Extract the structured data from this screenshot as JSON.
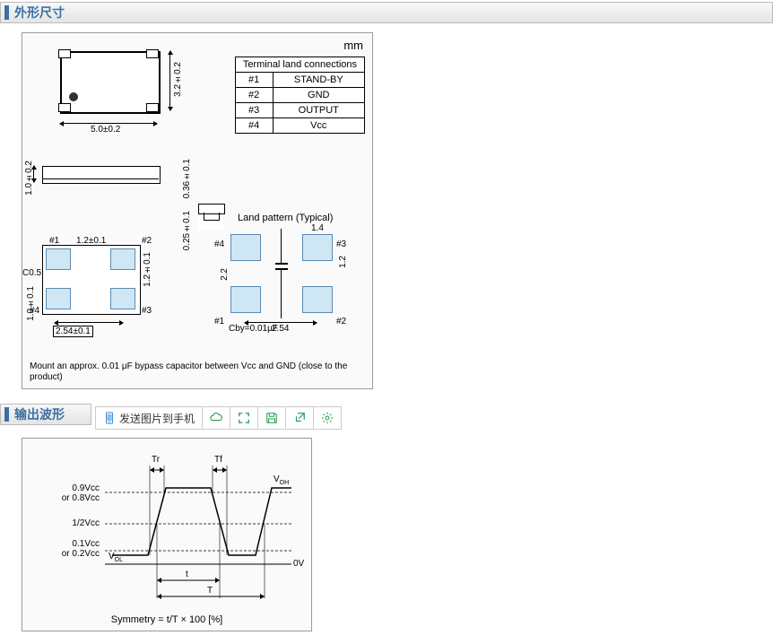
{
  "sections": {
    "dims_title": "外形尺寸",
    "wave_title": "输出波形"
  },
  "toolbar": {
    "send_label": "发送图片到手机"
  },
  "dimensions": {
    "unit": "mm",
    "terminal_header": "Terminal land connections",
    "pins": [
      {
        "num": "#1",
        "name": "STAND-BY"
      },
      {
        "num": "#2",
        "name": "GND"
      },
      {
        "num": "#3",
        "name": "OUTPUT"
      },
      {
        "num": "#4",
        "name": "Vcc"
      }
    ],
    "top_w": "5.0±0.2",
    "top_h": "3.2±0.2",
    "side_h": "1.0±0.2",
    "prof_h1": "0.36±0.1",
    "prof_h2": "0.25±0.1",
    "bot_pad_w": "1.2±0.1",
    "bot_pad_h": "1.2±0.1",
    "bot_pitch": "2.54±0.1",
    "bot_side": "1.0±0.1",
    "chamfer": "C0.5",
    "pin1": "#1",
    "pin2": "#2",
    "pin3": "#3",
    "pin4": "#4",
    "land_title": "Land pattern (Typical)",
    "land_w": "1.4",
    "land_h": "1.2",
    "land_pitch": "2.54",
    "land_gap": "2.2",
    "cby": "Cby=0.01μF",
    "note": "Mount an approx. 0.01 μF bypass capacitor between Vcc and GND (close to the product)"
  },
  "waveform": {
    "tr": "Tr",
    "tf": "Tf",
    "voh": "VOH",
    "vol": "VOL",
    "lvl_90": "0.9Vcc",
    "lvl_80": "or 0.8Vcc",
    "lvl_50": "1/2Vcc",
    "lvl_10": "0.1Vcc",
    "lvl_20": "or 0.2Vcc",
    "zero": "0V",
    "t_small": "t",
    "t_big": "T",
    "symmetry": "Symmetry = t/T × 100 [%]"
  }
}
